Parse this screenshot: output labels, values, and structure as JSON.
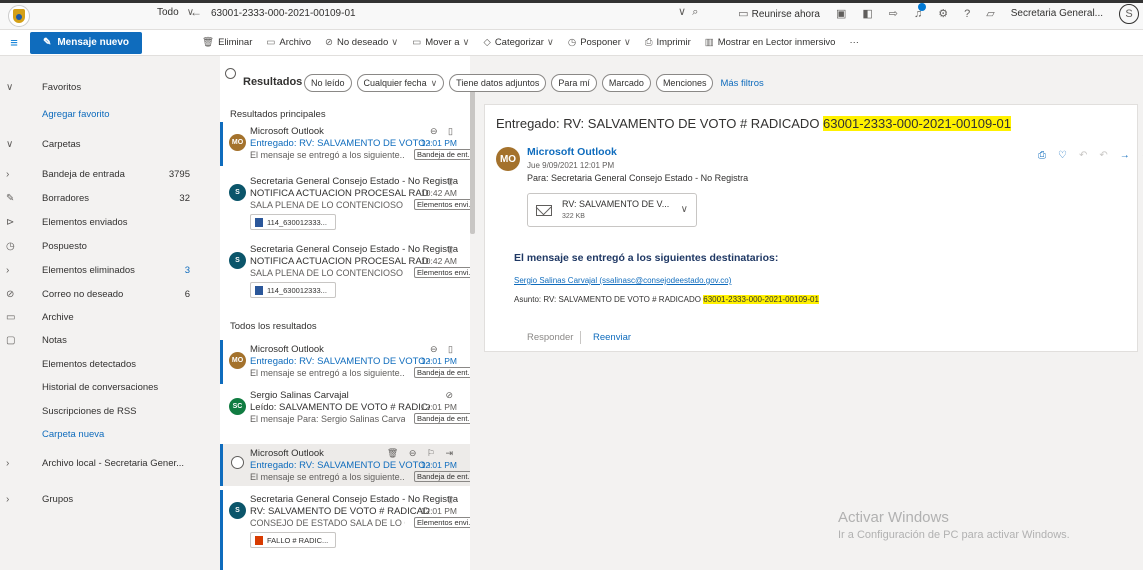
{
  "topbar": {
    "scope": "Todo",
    "search_query": "63001-2333-000-2021-00109-01",
    "meet_now": "Reunirse ahora",
    "account": "Secretaria General...",
    "account_initial": "S"
  },
  "commands": {
    "new_message": "Mensaje nuevo",
    "items": [
      {
        "label": "Eliminar",
        "icon": "trash-icon",
        "glyph": "🗑"
      },
      {
        "label": "Archivo",
        "icon": "archive-icon",
        "glyph": "▭",
        "chevron": false
      },
      {
        "label": "No deseado",
        "icon": "junk-icon",
        "glyph": "⊘",
        "chevron": true
      },
      {
        "label": "Mover a",
        "icon": "move-icon",
        "glyph": "▭",
        "chevron": true
      },
      {
        "label": "Categorizar",
        "icon": "tag-icon",
        "glyph": "◇",
        "chevron": true
      },
      {
        "label": "Posponer",
        "icon": "clock-icon",
        "glyph": "◷",
        "chevron": true
      },
      {
        "label": "Imprimir",
        "icon": "print-icon",
        "glyph": "⎙",
        "chevron": false
      },
      {
        "label": "Mostrar en Lector inmersivo",
        "icon": "reader-icon",
        "glyph": "▥",
        "chevron": false
      },
      {
        "label": "···",
        "icon": "more-icon",
        "glyph": "",
        "chevron": false
      }
    ]
  },
  "sidebar": {
    "favoritos": "Favoritos",
    "agregar_favorito": "Agregar favorito",
    "carpetas": "Carpetas",
    "folders": [
      {
        "name": "Bandeja de entrada",
        "count": "3795"
      },
      {
        "name": "Borradores",
        "count": "32"
      },
      {
        "name": "Elementos enviados",
        "count": ""
      },
      {
        "name": "Pospuesto",
        "count": ""
      },
      {
        "name": "Elementos eliminados",
        "count": "3"
      },
      {
        "name": "Correo no deseado",
        "count": "6"
      },
      {
        "name": "Archive",
        "count": ""
      },
      {
        "name": "Notas",
        "count": ""
      },
      {
        "name": "Elementos detectados",
        "count": ""
      },
      {
        "name": "Historial de conversaciones",
        "count": ""
      },
      {
        "name": "Suscripciones de RSS",
        "count": ""
      },
      {
        "name": "Carpeta nueva",
        "count": ""
      }
    ],
    "archivo_local": "Archivo local - Secretaria Gener...",
    "grupos": "Grupos"
  },
  "list": {
    "results_title": "Resultados",
    "filters": [
      "No leído",
      "Cualquier fecha",
      "Tiene datos adjuntos",
      "Para mí",
      "Marcado",
      "Menciones"
    ],
    "more_filters": "Más filtros",
    "top_results": "Resultados principales",
    "all_results": "Todos los resultados",
    "items": [
      {
        "from": "Microsoft Outlook",
        "subject": "Entregado: RV: SALVAMENTO DE VOTO # R...",
        "time": "12:01 PM",
        "preview": "El mensaje se entregó a los siguiente...",
        "tag": "Bandeja de ent...",
        "avatar": "MO"
      },
      {
        "from": "Secretaria General Consejo Estado - No Registra",
        "subject": "NOTIFICA ACTUACION PROCESAL RAD 2021...",
        "time": "10:42 AM",
        "preview": "SALA PLENA DE LO CONTENCIOSO ...",
        "tag": "Elementos envi...",
        "attachment": "114_630012333...",
        "avatar": "S"
      },
      {
        "from": "Secretaria General Consejo Estado - No Registra",
        "subject": "NOTIFICA ACTUACION PROCESAL RAD 2021...",
        "time": "10:42 AM",
        "preview": "SALA PLENA DE LO CONTENCIOSO ...",
        "tag": "Elementos envi...",
        "attachment": "114_630012333...",
        "avatar": "S"
      },
      {
        "from": "Microsoft Outlook",
        "subject": "Entregado: RV: SALVAMENTO DE VOTO # R...",
        "time": "12:01 PM",
        "preview": "El mensaje se entregó a los siguiente...",
        "tag": "Bandeja de ent...",
        "avatar": "MO"
      },
      {
        "from": "Sergio Salinas Carvajal",
        "subject": "Leído: SALVAMENTO DE VOTO # RADICADO",
        "subject_hl": "...",
        "time": "12:01 PM",
        "preview": "El mensaje Para: Sergio Salinas Carva...",
        "tag": "Bandeja de ent...",
        "avatar": "SC"
      },
      {
        "from": "Microsoft Outlook",
        "subject": "Entregado: RV: SALVAMENTO DE VOTO # R...",
        "time": "12:01 PM",
        "preview": "El mensaje se entregó a los siguiente...",
        "tag": "Bandeja de ent..."
      },
      {
        "from": "Secretaria General Consejo Estado - No Registra",
        "subject": "RV: SALVAMENTO DE VOTO # RADICADO ",
        "subject_hl": "6...",
        "time": "12:01 PM",
        "preview": "CONSEJO DE ESTADO SALA DE LO C...",
        "tag": "Elementos envi...",
        "attachment": "FALLO # RADIC...",
        "avatar": "S"
      }
    ]
  },
  "reading": {
    "subject_prefix": "Entregado: RV: SALVAMENTO DE VOTO # RADICADO ",
    "subject_hl": "63001-2333-000-2021-00109-01",
    "avatar": "MO",
    "from": "Microsoft Outlook",
    "date": "Jue 9/09/2021 12:01 PM",
    "to": "Para:  Secretaria General Consejo Estado - No Registra",
    "attachment_name": "RV: SALVAMENTO DE V...",
    "attachment_size": "322 KB",
    "delivered": "El mensaje se entregó a los siguientes destinatarios:",
    "recipient": "Sergio Salinas Carvajal (ssalinasc@consejodeestado.gov.co)",
    "asunto_prefix": "Asunto: RV: SALVAMENTO DE VOTO # RADICADO ",
    "asunto_hl": "63001-2333-000-2021-00109-01",
    "reply": "Responder",
    "forward": "Reenviar"
  },
  "watermark": {
    "line1": "Activar Windows",
    "line2": "Ir a Configuración de PC para activar Windows."
  },
  "colors": {
    "accent": "#0f6cbd",
    "highlight": "#fff100"
  }
}
